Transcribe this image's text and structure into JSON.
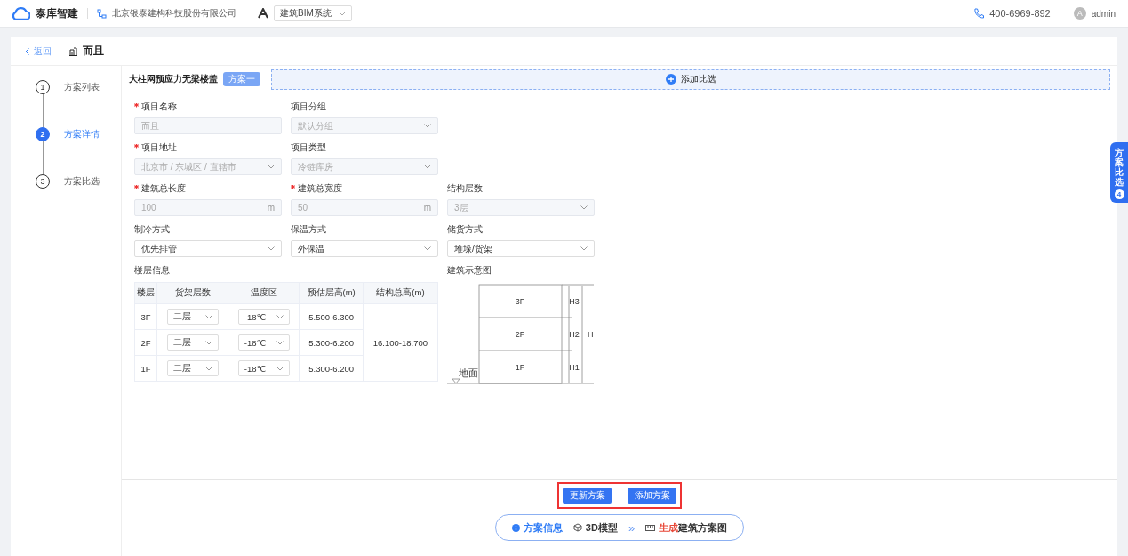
{
  "header": {
    "brand": "泰库智建",
    "company": "北京银泰建构科技股份有限公司",
    "system_select": "建筑BIM系统",
    "phone": "400-6969-892",
    "avatar": "A",
    "user": "admin"
  },
  "breadcrumb": {
    "back": "返回",
    "title": "而且"
  },
  "steps": [
    {
      "number": "1",
      "label": "方案列表",
      "selected": false
    },
    {
      "number": "2",
      "label": "方案详情",
      "selected": true
    },
    {
      "number": "3",
      "label": "方案比选",
      "selected": false
    }
  ],
  "scheme": {
    "title": "大柱网预应力无梁楼盖",
    "tag": "方案一",
    "add_compare": "添加比选"
  },
  "form_rows": [
    [
      {
        "label": "项目名称",
        "required": true,
        "kind": "input",
        "value": "而且",
        "disabled": true
      },
      {
        "label": "项目分组",
        "required": false,
        "kind": "select",
        "value": "默认分组",
        "disabled": true
      }
    ],
    [
      {
        "label": "项目地址",
        "required": true,
        "kind": "select",
        "value": "北京市 / 东城区 / 直辖市",
        "disabled": true
      },
      {
        "label": "项目类型",
        "required": false,
        "kind": "select",
        "value": "冷链库房",
        "disabled": true
      }
    ],
    [
      {
        "label": "建筑总长度",
        "required": true,
        "kind": "input",
        "value": "100",
        "unit": "m",
        "disabled": true
      },
      {
        "label": "建筑总宽度",
        "required": true,
        "kind": "input",
        "value": "50",
        "unit": "m",
        "disabled": true
      },
      {
        "label": "结构层数",
        "required": false,
        "kind": "select",
        "value": "3层",
        "disabled": true
      }
    ],
    [
      {
        "label": "制冷方式",
        "required": false,
        "kind": "select",
        "value": "优先排管",
        "disabled": false
      },
      {
        "label": "保温方式",
        "required": false,
        "kind": "select",
        "value": "外保温",
        "disabled": false
      },
      {
        "label": "储货方式",
        "required": false,
        "kind": "select",
        "value": "堆垛/货架",
        "disabled": false
      }
    ]
  ],
  "floor_table": {
    "title": "楼层信息",
    "columns": [
      "楼层",
      "货架层数",
      "温度区",
      "预估层高(m)",
      "结构总高(m)"
    ],
    "rows": [
      {
        "floor": "3F",
        "shelves": "二层",
        "temperature": "-18℃",
        "height": "5.500-6.300"
      },
      {
        "floor": "2F",
        "shelves": "二层",
        "temperature": "-18℃",
        "height": "5.300-6.200"
      },
      {
        "floor": "1F",
        "shelves": "二层",
        "temperature": "-18℃",
        "height": "5.300-6.200"
      }
    ],
    "total_height": "16.100-18.700"
  },
  "diagram": {
    "title": "建筑示意图",
    "floors": [
      "3F",
      "2F",
      "1F"
    ],
    "dims": [
      "H3",
      "H2",
      "H1"
    ],
    "total": "H",
    "ground": "地面"
  },
  "side_tab": {
    "label": "方案比选",
    "badge": "4"
  },
  "actions": [
    "更新方案",
    "添加方案"
  ],
  "bottom_nav": {
    "info": "方案信息",
    "model": "3D模型",
    "sep": "»",
    "generate_highlight": "生成",
    "generate": "建筑方案图"
  }
}
